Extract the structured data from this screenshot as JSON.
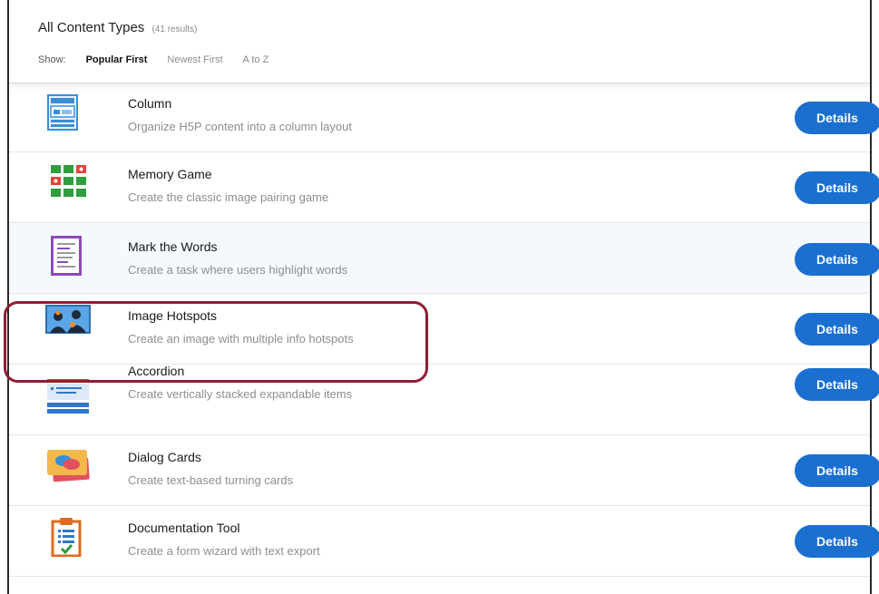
{
  "header": {
    "title": "All Content Types",
    "result_count": "(41 results)",
    "show_label": "Show:",
    "sort_options": [
      "Popular First",
      "Newest First",
      "A to Z"
    ]
  },
  "items": [
    {
      "title": "Column",
      "description": "Organize H5P content into a column layout",
      "button": "Details",
      "icon": "column-icon"
    },
    {
      "title": "Memory Game",
      "description": "Create the classic image pairing game",
      "button": "Details",
      "icon": "memory-game-icon"
    },
    {
      "title": "Mark the Words",
      "description": "Create a task where users highlight words",
      "button": "Details",
      "icon": "mark-the-words-icon"
    },
    {
      "title": "Image Hotspots",
      "description": "Create an image with multiple info hotspots",
      "button": "Details",
      "icon": "image-hotspots-icon"
    },
    {
      "title": "Accordion",
      "description": "Create vertically stacked expandable items",
      "button": "Details",
      "icon": "accordion-icon"
    },
    {
      "title": "Dialog Cards",
      "description": "Create text-based turning cards",
      "button": "Details",
      "icon": "dialog-cards-icon"
    },
    {
      "title": "Documentation Tool",
      "description": "Create a form wizard with text export",
      "button": "Details",
      "icon": "documentation-tool-icon"
    }
  ],
  "colors": {
    "details_button": "#1a6fcf",
    "highlight_border": "#8f1e32"
  }
}
